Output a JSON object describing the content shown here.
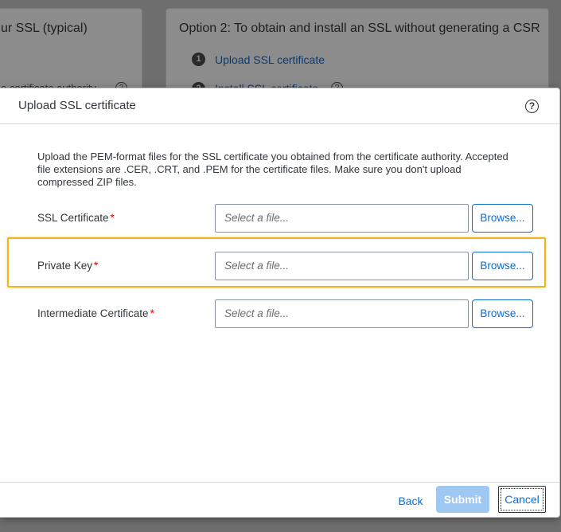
{
  "background": {
    "option1_title": "ur SSL (typical)",
    "option1_ghost": "e certificate authority",
    "option2_title": "Option 2: To obtain and install an SSL without generating a CSR",
    "option2_steps": [
      {
        "num": "1",
        "label": "Upload SSL certificate"
      },
      {
        "num": "2",
        "label": "Install SSL certificate"
      }
    ]
  },
  "dialog": {
    "title": "Upload SSL certificate",
    "help_icon": "question-circle-icon",
    "description": "Upload the PEM-format files for the SSL certificate you obtained from the certificate authority. Accepted file extensions are .CER, .CRT, and .PEM for the certificate files. Make sure you don't upload compressed ZIP files.",
    "fields": [
      {
        "label": "SSL Certificate",
        "required_mark": "*",
        "placeholder": "Select a file...",
        "browse": "Browse..."
      },
      {
        "label": "Private Key",
        "required_mark": "*",
        "placeholder": "Select a file...",
        "browse": "Browse..."
      },
      {
        "label": "Intermediate Certificate",
        "required_mark": "*",
        "placeholder": "Select a file...",
        "browse": "Browse..."
      }
    ],
    "footer": {
      "back": "Back",
      "submit": "Submit",
      "cancel": "Cancel"
    }
  },
  "colors": {
    "accent": "#0a6ed1",
    "highlight": "#f0b323",
    "required": "#dd0000",
    "submit_disabled": "#9ec8f1"
  }
}
